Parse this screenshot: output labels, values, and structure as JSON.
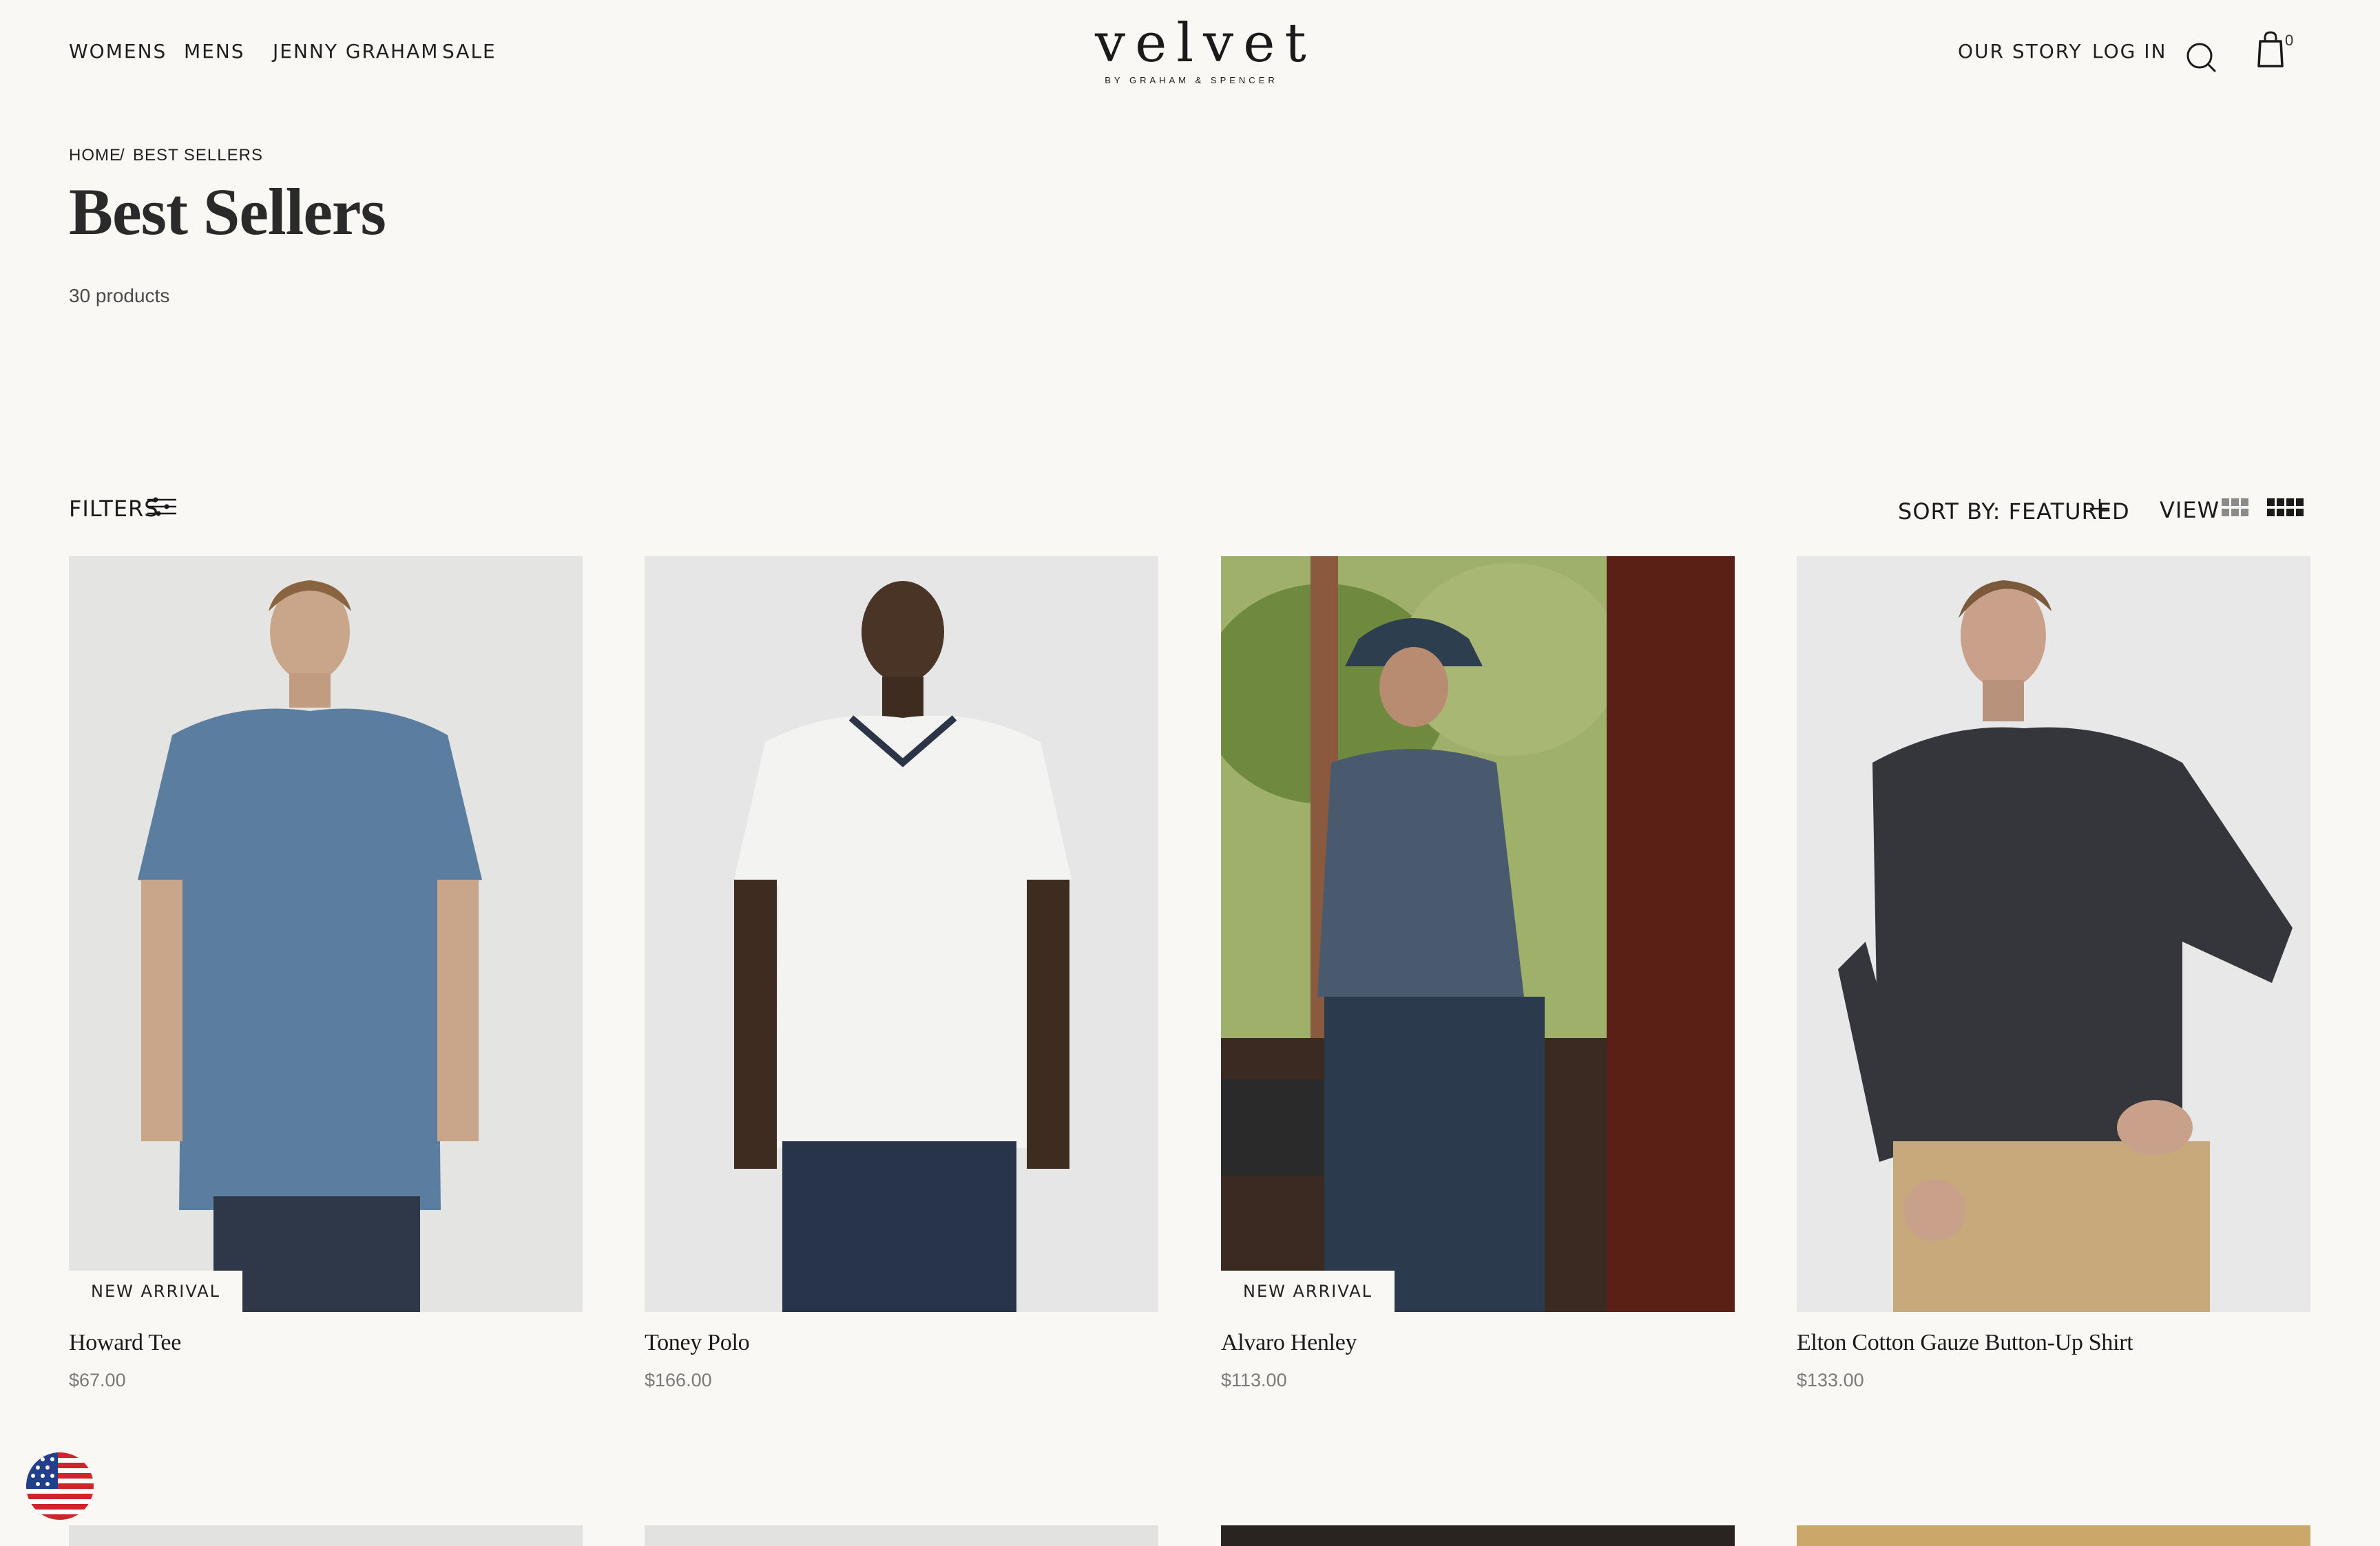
{
  "header": {
    "nav_left": [
      "WOMENS",
      "MENS",
      "JENNY GRAHAM",
      "SALE"
    ],
    "logo": {
      "word": "velvet",
      "tagline": "BY GRAHAM & SPENCER"
    },
    "nav_right": [
      "OUR STORY",
      "LOG IN"
    ],
    "cart_count": "0",
    "icons": [
      "search-icon",
      "shopping-bag-icon"
    ]
  },
  "breadcrumb": {
    "home": "HOME",
    "separator": "/",
    "current": "BEST SELLERS"
  },
  "page": {
    "title": "Best Sellers",
    "count": "30 products"
  },
  "toolbar": {
    "filters_label": "FILTERS",
    "sort_label": "SORT BY: FEATURED",
    "view_label": "VIEW"
  },
  "products": [
    {
      "name": "Howard Tee",
      "price": "$67.00",
      "badge": "NEW ARRIVAL"
    },
    {
      "name": "Toney Polo",
      "price": "$166.00",
      "badge": ""
    },
    {
      "name": "Alvaro Henley",
      "price": "$113.00",
      "badge": "NEW ARRIVAL"
    },
    {
      "name": "Elton Cotton Gauze Button-Up Shirt",
      "price": "$133.00",
      "badge": ""
    }
  ],
  "colors": {
    "background": "#f9f8f5",
    "text": "#1c1c1c",
    "muted": "#7a7a7a"
  },
  "locale_flag": "us-flag-icon"
}
